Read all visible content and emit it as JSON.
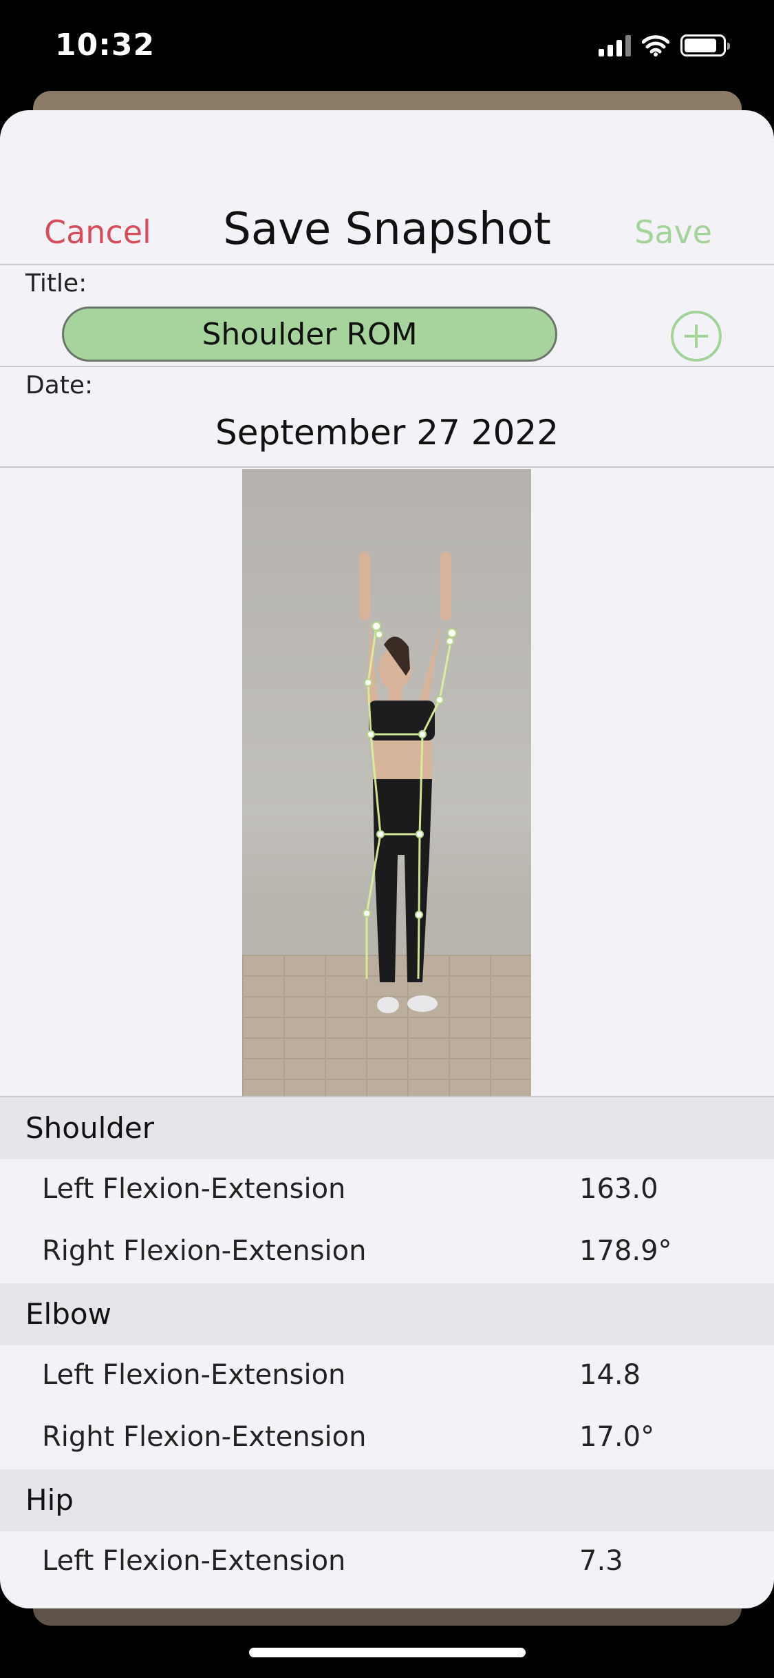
{
  "status_bar": {
    "time": "10:32"
  },
  "nav": {
    "cancel_label": "Cancel",
    "title": "Save Snapshot",
    "save_label": "Save"
  },
  "form": {
    "title_label": "Title:",
    "title_value": "Shoulder ROM",
    "date_label": "Date:",
    "date_value": "September 27 2022"
  },
  "measurements": [
    {
      "joint": "Shoulder",
      "rows": [
        {
          "name": "Left Flexion-Extension",
          "value": "163.0"
        },
        {
          "name": "Right Flexion-Extension",
          "value": "178.9°"
        }
      ]
    },
    {
      "joint": "Elbow",
      "rows": [
        {
          "name": "Left Flexion-Extension",
          "value": "14.8"
        },
        {
          "name": "Right Flexion-Extension",
          "value": "17.0°"
        }
      ]
    },
    {
      "joint": "Hip",
      "rows": [
        {
          "name": "Left Flexion-Extension",
          "value": "7.3"
        }
      ]
    }
  ],
  "colors": {
    "cancel": "#d64c5a",
    "accent_green": "#a4d39a",
    "pill_green": "#a7d49c",
    "background": "#f2f2f7"
  },
  "icons": {
    "add": "plus-circle-icon",
    "signal": "cellular-signal-icon",
    "wifi": "wifi-icon",
    "battery": "battery-icon"
  }
}
